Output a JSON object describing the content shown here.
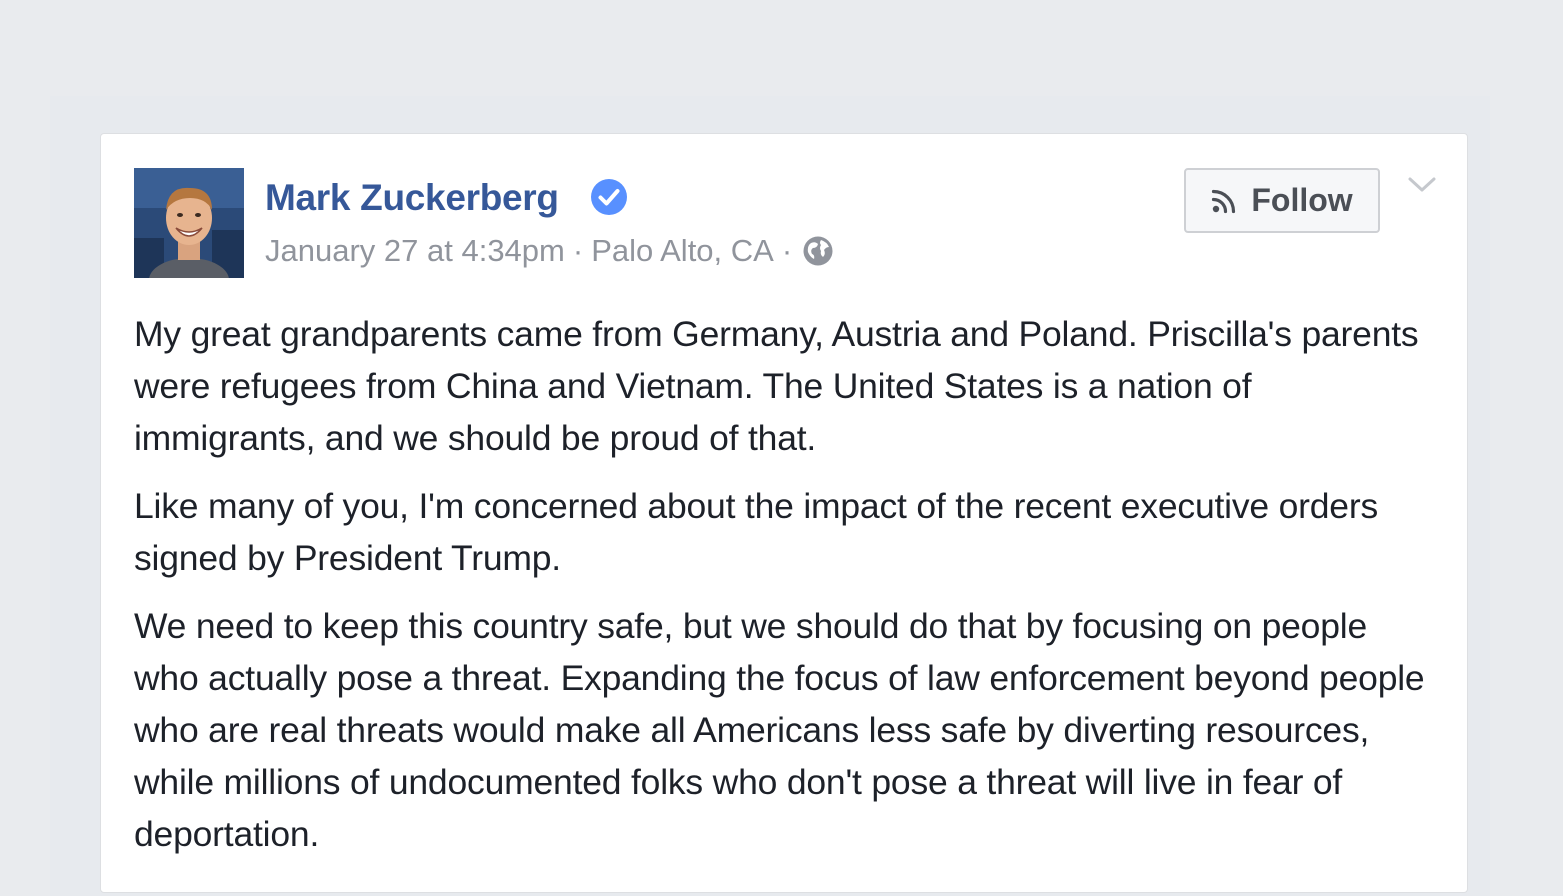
{
  "post": {
    "author": "Mark Zuckerberg",
    "date": "January 27 at 4:34pm",
    "separator": "·",
    "location": "Palo Alto, CA",
    "follow_label": "Follow",
    "paragraphs": [
      "My great grandparents came from Germany, Austria and Poland. Priscilla's parents were refugees from China and Vietnam. The United States is a nation of immigrants, and we should be proud of that.",
      "Like many of you, I'm concerned about the impact of the recent executive orders signed by President Trump.",
      "We need to keep this country safe, but we should do that by focusing on people who actually pose a threat. Expanding the focus of law enforcement beyond people who are real threats would make all Americans less safe by diverting resources, while millions of undocumented folks who don't pose a threat will live in fear of deportation."
    ]
  },
  "icons": {
    "verified": "verified-badge-icon",
    "privacy": "globe-icon",
    "follow": "rss-icon",
    "menu": "chevron-down-icon"
  },
  "colors": {
    "page_background": "#e9ebee",
    "author_link": "#365899",
    "verified_badge": "#5890ff",
    "meta_text": "#90949c",
    "body_text": "#1d2129",
    "follow_text": "#4b4f56"
  }
}
